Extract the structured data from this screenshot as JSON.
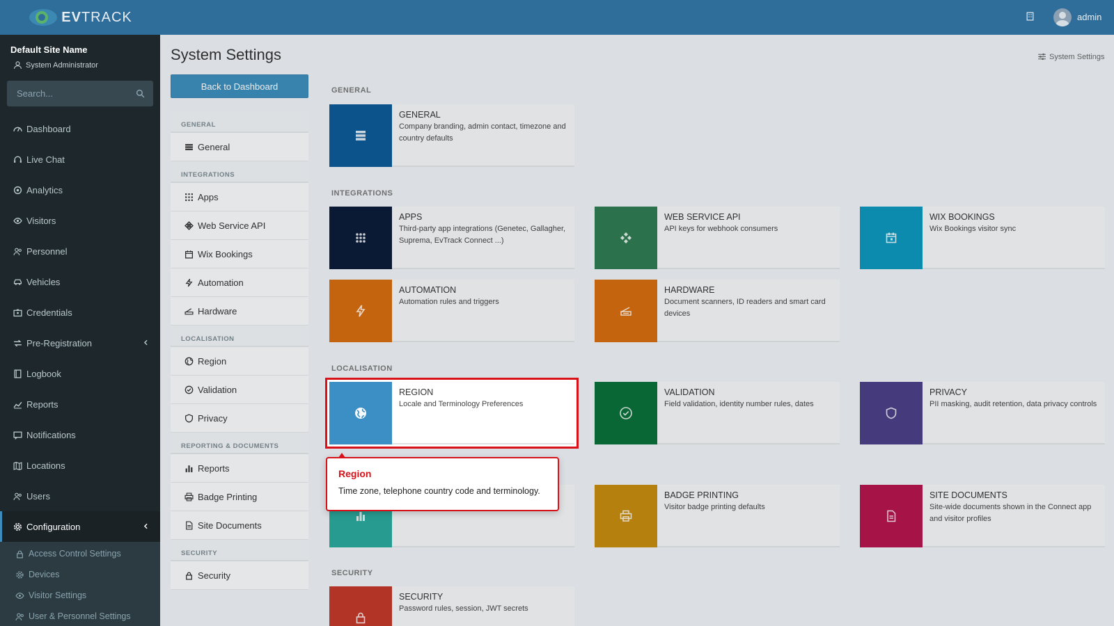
{
  "brand": {
    "logo_text_bold": "EV",
    "logo_text": "TRACK"
  },
  "topbar": {
    "user": "admin"
  },
  "sidebar": {
    "site_name": "Default Site Name",
    "role": "System Administrator",
    "search_placeholder": "Search...",
    "items": [
      {
        "label": "Dashboard"
      },
      {
        "label": "Live Chat"
      },
      {
        "label": "Analytics"
      },
      {
        "label": "Visitors"
      },
      {
        "label": "Personnel"
      },
      {
        "label": "Vehicles"
      },
      {
        "label": "Credentials"
      },
      {
        "label": "Pre-Registration"
      },
      {
        "label": "Logbook"
      },
      {
        "label": "Reports"
      },
      {
        "label": "Notifications"
      },
      {
        "label": "Locations"
      },
      {
        "label": "Users"
      },
      {
        "label": "Configuration"
      }
    ],
    "sub_items": [
      {
        "label": "Access Control Settings"
      },
      {
        "label": "Devices"
      },
      {
        "label": "Visitor Settings"
      },
      {
        "label": "User & Personnel Settings"
      }
    ]
  },
  "page": {
    "title": "System Settings",
    "breadcrumb": "System Settings",
    "back_button": "Back to Dashboard"
  },
  "settings_nav": {
    "sections": [
      "GENERAL",
      "INTEGRATIONS",
      "LOCALISATION",
      "REPORTING & DOCUMENTS",
      "SECURITY"
    ],
    "items": {
      "general": "General",
      "apps": "Apps",
      "web_service_api": "Web Service API",
      "wix_bookings": "Wix Bookings",
      "automation": "Automation",
      "hardware": "Hardware",
      "region": "Region",
      "validation": "Validation",
      "privacy": "Privacy",
      "reports": "Reports",
      "badge_printing": "Badge Printing",
      "site_documents": "Site Documents",
      "security": "Security"
    }
  },
  "sections": {
    "general": "GENERAL",
    "integrations": "INTEGRATIONS",
    "localisation": "LOCALISATION",
    "security": "SECURITY"
  },
  "cards": {
    "general": {
      "title": "GENERAL",
      "desc": "Company branding, admin contact, timezone and country defaults",
      "color": "#0f5a96",
      "icon": "server-icon"
    },
    "apps": {
      "title": "APPS",
      "desc": "Third-party app integrations (Genetec, Gallagher, Suprema, EvTrack Connect ...)",
      "color": "#0b1c3a",
      "icon": "grid-icon"
    },
    "web_service_api": {
      "title": "WEB SERVICE API",
      "desc": "API keys for webhook consumers",
      "color": "#2f7a52",
      "icon": "api-icon"
    },
    "wix_bookings": {
      "title": "WIX BOOKINGS",
      "desc": "Wix Bookings visitor sync",
      "color": "#0d96bd",
      "icon": "calendar-icon"
    },
    "automation": {
      "title": "AUTOMATION",
      "desc": "Automation rules and triggers",
      "color": "#d46c10",
      "icon": "bolt-icon"
    },
    "hardware": {
      "title": "HARDWARE",
      "desc": "Document scanners, ID readers and smart card devices",
      "color": "#d46c10",
      "icon": "scanner-icon"
    },
    "region": {
      "title": "REGION",
      "desc": "Locale and Terminology Preferences",
      "color": "#3b8fc4",
      "icon": "globe-icon"
    },
    "validation": {
      "title": "VALIDATION",
      "desc": "Field validation, identity number rules, dates",
      "color": "#0a6e3a",
      "icon": "check-circle-icon"
    },
    "privacy": {
      "title": "PRIVACY",
      "desc": "PII masking, audit retention, data privacy controls",
      "color": "#4a3f86",
      "icon": "shield-icon"
    },
    "reports": {
      "title": "",
      "desc": "",
      "color": "#2aa79b",
      "icon": "bar-chart-icon"
    },
    "badge_printing": {
      "title": "BADGE PRINTING",
      "desc": "Visitor badge printing defaults",
      "color": "#c38a10",
      "icon": "printer-icon"
    },
    "site_documents": {
      "title": "SITE DOCUMENTS",
      "desc": "Site-wide documents shown in the Connect app and visitor profiles",
      "color": "#b3154c",
      "icon": "document-icon"
    },
    "security": {
      "title": "SECURITY",
      "desc": "Password rules, session, JWT secrets",
      "color": "#c0392b",
      "icon": "lock-icon"
    }
  },
  "tooltip": {
    "title": "Region",
    "body": "Time zone, telephone country code and terminology."
  }
}
